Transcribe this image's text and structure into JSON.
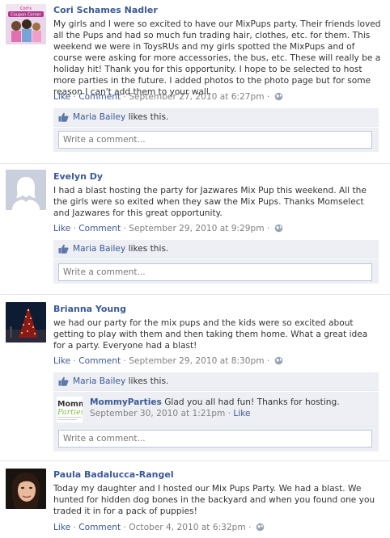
{
  "posts": [
    {
      "author": "Cori Schames Nadler",
      "avatar_icon": "profile-photo-coupon-corner",
      "avatar_caption": "Coupon Corner",
      "message": "My girls and I were so excited to have our MixPups party. Their friends loved all the Pups and had so much fun trading hair, clothes, etc. for them. This weekend we were in ToysRUs and my girls spotted the MixPups and of course were asking for more accessories, the bus, etc. These will really be a holiday hit! Thank you for this opportunity. I hope to be selected to host more parties in the future. I added photos to the photo page but for some reason I can't add them to your wall.",
      "like_label": "Like",
      "comment_label": "Comment",
      "timestamp": "September 27, 2010 at 6:27pm",
      "liker": "Maria Bailey",
      "likes_suffix": "likes this.",
      "comment_placeholder": "Write a comment..."
    },
    {
      "author": "Evelyn Dy",
      "avatar_icon": "default-female-avatar",
      "message": "I had a blast hosting the party for Jazwares Mix Pup this weekend. All the the girls were so exited when they saw the Mix Pups. Thanks Momselect and Jazwares for this great opportunity.",
      "like_label": "Like",
      "comment_label": "Comment",
      "timestamp": "September 29, 2010 at 9:29pm",
      "liker": "Maria Bailey",
      "likes_suffix": "likes this.",
      "comment_placeholder": "Write a comment..."
    },
    {
      "author": "Brianna Young",
      "avatar_icon": "profile-photo-christmas-tree",
      "message": "we had our party for the mix pups and the kids were so excited about getting to play with them and then taking them home. What a great idea for a party. Everyone had a blast!",
      "like_label": "Like",
      "comment_label": "Comment",
      "timestamp": "September 29, 2010 at 8:30pm",
      "liker": "Maria Bailey",
      "likes_suffix": "likes this.",
      "reply": {
        "author": "MommyParties",
        "avatar_icon": "mommyparties-logo",
        "logo_text_top": "Mommy",
        "logo_text_bottom": "Parties",
        "message": "Glad you all had fun! Thanks for hosting.",
        "timestamp": "September 30, 2010 at 1:21pm",
        "like_label": "Like"
      },
      "comment_placeholder": "Write a comment..."
    },
    {
      "author": "Paula Badalucca-Rangel",
      "avatar_icon": "profile-photo-woman",
      "message": "Today my daughter and I hosted our Mix Pups Party. We had a blast. We hunted for hidden dog bones in the backyard and when you found one you traded it in for a pack of puppies!",
      "like_label": "Like",
      "comment_label": "Comment",
      "timestamp": "October 4, 2010 at 6:32pm"
    }
  ],
  "colors": {
    "link": "#3b5998",
    "meta": "#808080",
    "feedback_bg": "#edeff4",
    "input_border": "#bdc7d8"
  },
  "separator": " · "
}
